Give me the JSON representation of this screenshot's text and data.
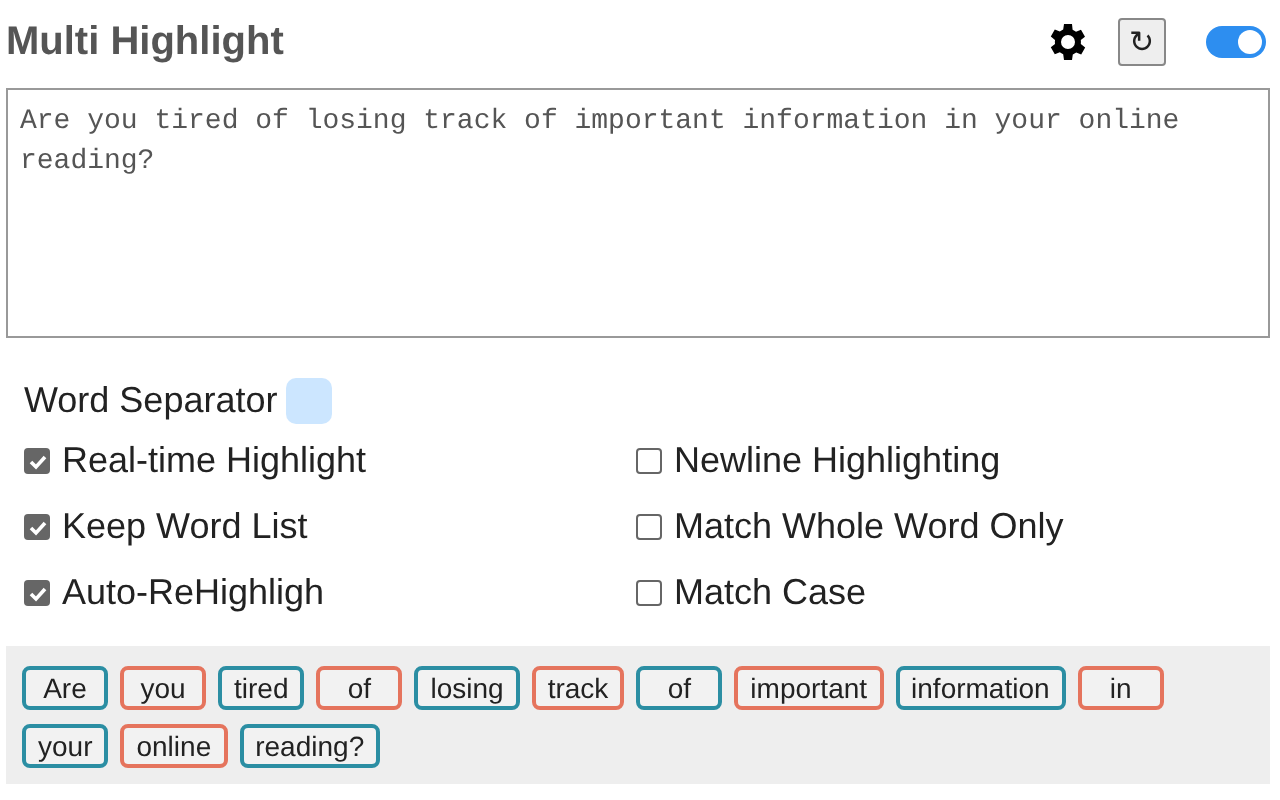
{
  "title": "Multi Highlight",
  "toolbar": {
    "refresh_symbol": "↻",
    "enabled": true
  },
  "text_input": {
    "value": "Are you tired of losing track of important information in your online reading?"
  },
  "separator": {
    "label": "Word Separator"
  },
  "options": [
    {
      "label": "Real-time Highlight",
      "checked": true
    },
    {
      "label": "Newline Highlighting",
      "checked": false
    },
    {
      "label": "Keep Word List",
      "checked": true
    },
    {
      "label": "Match Whole Word Only",
      "checked": false
    },
    {
      "label": "Auto-ReHighligh",
      "checked": true
    },
    {
      "label": "Match Case",
      "checked": false
    }
  ],
  "words": [
    {
      "text": "Are",
      "color": "#2b8ea3"
    },
    {
      "text": "you",
      "color": "#e5745d"
    },
    {
      "text": "tired",
      "color": "#2b8ea3"
    },
    {
      "text": "of",
      "color": "#e5745d"
    },
    {
      "text": "losing",
      "color": "#2b8ea3"
    },
    {
      "text": "track",
      "color": "#e5745d"
    },
    {
      "text": "of",
      "color": "#2b8ea3"
    },
    {
      "text": "important",
      "color": "#e5745d"
    },
    {
      "text": "information",
      "color": "#2b8ea3"
    },
    {
      "text": "in",
      "color": "#e5745d"
    },
    {
      "text": "your",
      "color": "#2b8ea3"
    },
    {
      "text": "online",
      "color": "#e5745d"
    },
    {
      "text": "reading?",
      "color": "#2b8ea3"
    }
  ]
}
